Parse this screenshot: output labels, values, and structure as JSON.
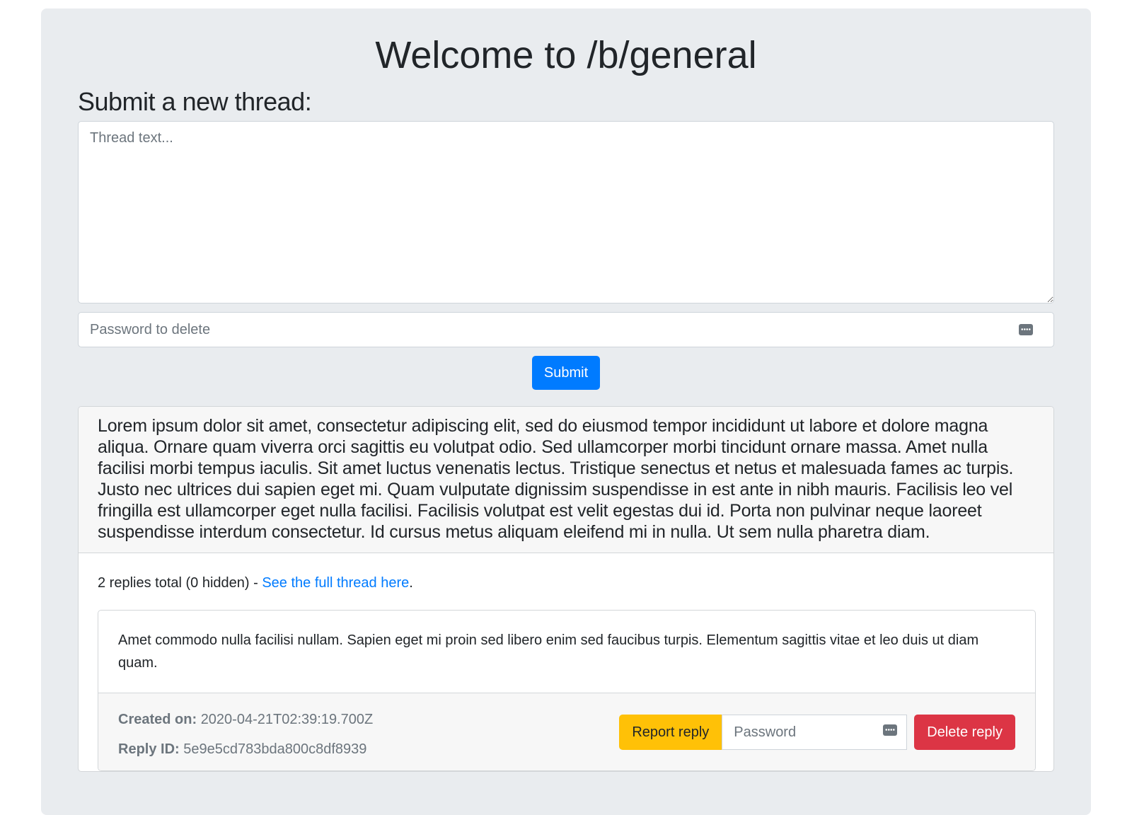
{
  "page": {
    "title": "Welcome to /b/general"
  },
  "new_thread": {
    "heading": "Submit a new thread:",
    "text_placeholder": "Thread text...",
    "password_placeholder": "Password to delete",
    "submit_label": "Submit"
  },
  "thread": {
    "text": "Lorem ipsum dolor sit amet, consectetur adipiscing elit, sed do eiusmod tempor incididunt ut labore et dolore magna aliqua. Ornare quam viverra orci sagittis eu volutpat odio. Sed ullamcorper morbi tincidunt ornare massa. Amet nulla facilisi morbi tempus iaculis. Sit amet luctus venenatis lectus. Tristique senectus et netus et malesuada fames ac turpis. Justo nec ultrices dui sapien eget mi. Quam vulputate dignissim suspendisse in est ante in nibh mauris. Facilisis leo vel fringilla est ullamcorper eget nulla facilisi. Facilisis volutpat est velit egestas dui id. Porta non pulvinar neque laoreet suspendisse interdum consectetur. Id cursus metus aliquam eleifend mi in nulla. Ut sem nulla pharetra diam.",
    "replies_summary": "2 replies total (0 hidden) - ",
    "full_thread_link": "See the full thread here",
    "summary_suffix": ".",
    "replies": [
      {
        "text": "Amet commodo nulla facilisi nullam. Sapien eget mi proin sed libero enim sed faucibus turpis. Elementum sagittis vitae et leo duis ut diam quam.",
        "created_label": "Created on:",
        "created_value": "2020-04-21T02:39:19.700Z",
        "id_label": "Reply ID:",
        "id_value": "5e9e5cd783bda800c8df8939",
        "report_label": "Report reply",
        "password_placeholder": "Password",
        "delete_label": "Delete reply"
      }
    ]
  },
  "icons": {
    "password_field_icon": "password-key-icon"
  },
  "colors": {
    "primary": "#007bff",
    "warning": "#ffc107",
    "danger": "#dc3545",
    "jumbotron_bg": "#e9ecef"
  }
}
